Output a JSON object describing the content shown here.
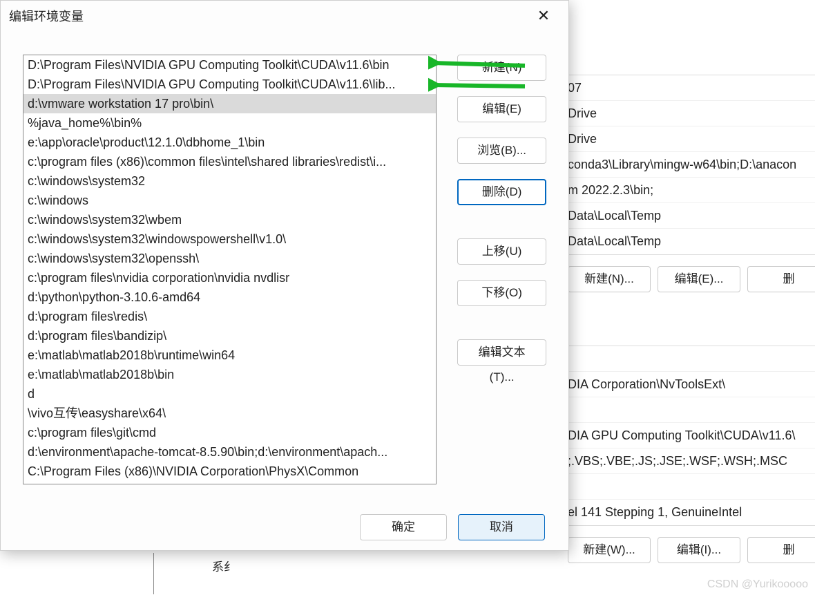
{
  "watermark": "CSDN @Yurikooooo",
  "parent": {
    "sys_label": "系纟",
    "rows_top": [
      "07",
      "Drive",
      "Drive",
      "conda3\\Library\\mingw-w64\\bin;D:\\anacon",
      "m 2022.2.3\\bin;",
      "Data\\Local\\Temp",
      "Data\\Local\\Temp"
    ],
    "buttons_top": [
      "新建(N)...",
      "编辑(E)...",
      "删"
    ],
    "rows_bottom": [
      "",
      "DIA Corporation\\NvToolsExt\\",
      "",
      "DIA GPU Computing Toolkit\\CUDA\\v11.6\\",
      ";.VBS;.VBE;.JS;.JSE;.WSF;.WSH;.MSC",
      "",
      "el 141 Stepping 1, GenuineIntel"
    ],
    "buttons_bottom": [
      "新建(W)...",
      "编辑(I)...",
      "删"
    ]
  },
  "dialog": {
    "title": "编辑环境变量",
    "items": [
      "D:\\Program Files\\NVIDIA GPU Computing Toolkit\\CUDA\\v11.6\\bin",
      "D:\\Program Files\\NVIDIA GPU Computing Toolkit\\CUDA\\v11.6\\lib...",
      "d:\\vmware workstation 17 pro\\bin\\",
      "%java_home%\\bin%",
      "e:\\app\\oracle\\product\\12.1.0\\dbhome_1\\bin",
      "c:\\program files (x86)\\common files\\intel\\shared libraries\\redist\\i...",
      "c:\\windows\\system32",
      "c:\\windows",
      "c:\\windows\\system32\\wbem",
      "c:\\windows\\system32\\windowspowershell\\v1.0\\",
      "c:\\windows\\system32\\openssh\\",
      "c:\\program files\\nvidia corporation\\nvidia nvdlisr",
      "d:\\python\\python-3.10.6-amd64",
      "d:\\program files\\redis\\",
      "d:\\program files\\bandizip\\",
      "e:\\matlab\\matlab2018b\\runtime\\win64",
      "e:\\matlab\\matlab2018b\\bin",
      "d",
      "\\vivo互传\\easyshare\\x64\\",
      "c:\\program files\\git\\cmd",
      "d:\\environment\\apache-tomcat-8.5.90\\bin;d:\\environment\\apach...",
      "C:\\Program Files (x86)\\NVIDIA Corporation\\PhysX\\Common"
    ],
    "selected_index": 2,
    "buttons": {
      "new": "新建(N)",
      "edit": "编辑(E)",
      "browse": "浏览(B)...",
      "delete": "删除(D)",
      "up": "上移(U)",
      "down": "下移(O)",
      "edit_text": "编辑文本(T)..."
    },
    "footer": {
      "ok": "确定",
      "cancel": "取消"
    }
  }
}
